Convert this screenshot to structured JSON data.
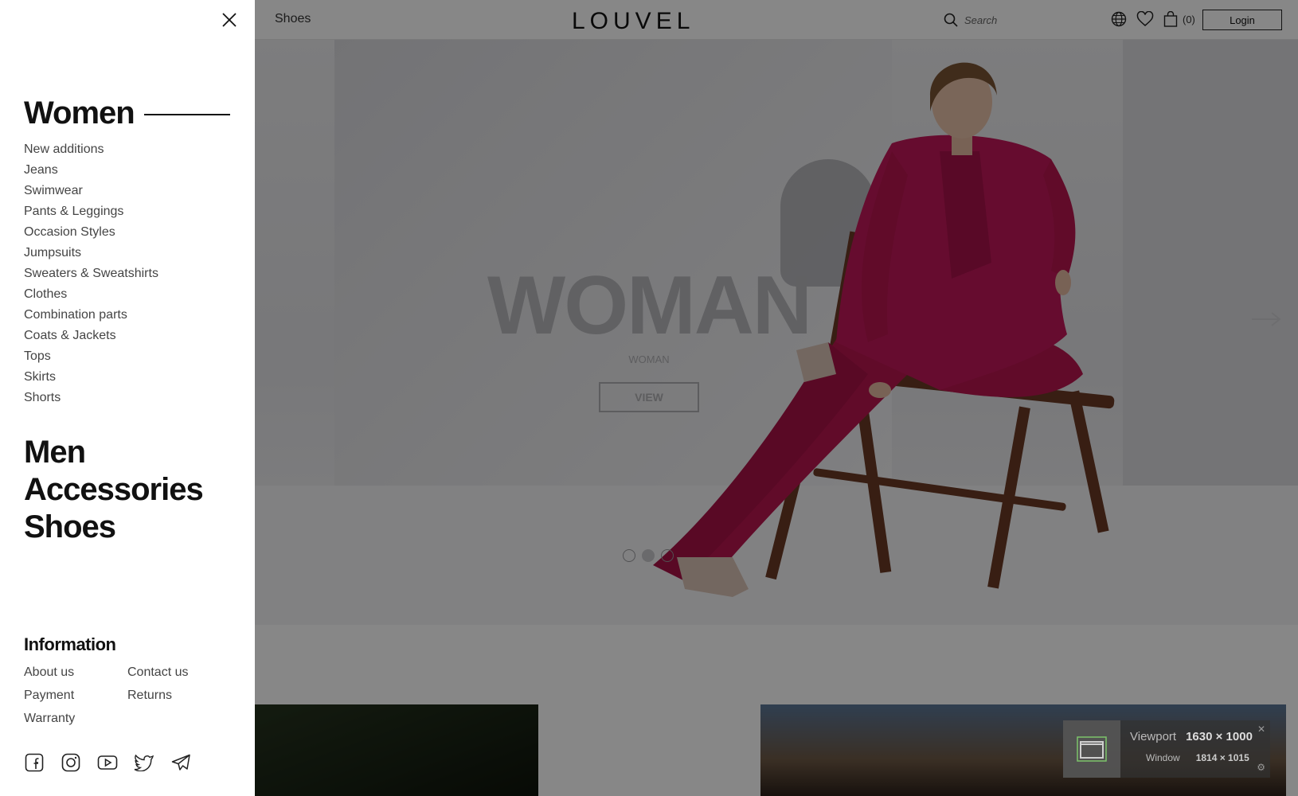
{
  "header": {
    "breadcrumb": "Shoes",
    "logo": "LOUVEL",
    "search_placeholder": "Search",
    "cart_count": "(0)",
    "login_label": "Login"
  },
  "hero": {
    "title": "WOMAN",
    "subtitle": "WOMAN",
    "button_label": "VIEW",
    "slide_count": 3,
    "active_slide": 2
  },
  "drawer": {
    "active_category": "Women",
    "women_items": [
      "New additions",
      "Jeans",
      "Swimwear",
      "Pants & Leggings",
      "Occasion Styles",
      "Jumpsuits",
      "Sweaters & Sweatshirts",
      "Clothes",
      "Combination parts",
      "Coats & Jackets",
      "Tops",
      "Skirts",
      "Shorts"
    ],
    "categories": [
      "Men",
      "Accessories",
      "Shoes"
    ],
    "info_title": "Information",
    "info_links": [
      "About us",
      "Contact us",
      "Payment",
      "Returns",
      "Warranty"
    ],
    "socials": [
      "facebook-icon",
      "instagram-icon",
      "youtube-icon",
      "twitter-icon",
      "telegram-icon"
    ]
  },
  "viewport_widget": {
    "viewport_label": "Viewport",
    "viewport_value": "1630 × 1000",
    "window_label": "Window",
    "window_value": "1814 × 1015"
  },
  "colors": {
    "overlay": "#000000",
    "hero_suit": "#b8154f",
    "text_dark": "#111111",
    "text_muted": "#444444"
  }
}
